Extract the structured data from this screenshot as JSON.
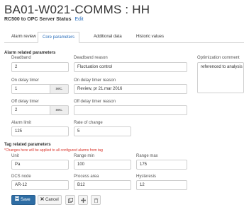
{
  "header": {
    "title": "BA01-W021-COMMS : HH",
    "subtitle": "RC500 to OPC Server Status",
    "edit_link": "Edit"
  },
  "tabs": [
    {
      "label": "Alarm review",
      "active": false
    },
    {
      "label": "Core parameters",
      "active": true
    },
    {
      "label": "Additional data",
      "active": false
    },
    {
      "label": "Historic values",
      "active": false
    }
  ],
  "alarm_section": {
    "title": "Alarm related parameters",
    "deadband": {
      "label": "Deadband",
      "value": "2"
    },
    "deadband_reason": {
      "label": "Deadband reason",
      "value": "Fluctuation control"
    },
    "optimization_comment": {
      "label": "Optimization comment",
      "value": "referenced to analysis"
    },
    "on_delay_timer": {
      "label": "On delay timer",
      "value": "1",
      "unit": "sec."
    },
    "on_delay_timer_reason": {
      "label": "On delay timer reason",
      "value": "Review, pr 21.mar 2016"
    },
    "off_delay_timer": {
      "label": "Off delay timer",
      "value": "2",
      "unit": "sec."
    },
    "off_delay_timer_reason": {
      "label": "Off delay timer reason",
      "value": ""
    },
    "alarm_limit": {
      "label": "Alarm limit",
      "value": "125"
    },
    "rate_of_change": {
      "label": "Rate of change",
      "value": "5"
    }
  },
  "tag_section": {
    "title": "Tag related parameters",
    "warning": "*Changes here will be applied to all configured alarms from tag",
    "unit": {
      "label": "Unit",
      "value": "Pa"
    },
    "range_min": {
      "label": "Range min",
      "value": "100"
    },
    "range_max": {
      "label": "Range max",
      "value": "175"
    },
    "dcs_node": {
      "label": "DCS node",
      "value": "AR-12"
    },
    "process_area": {
      "label": "Process area",
      "value": "B12"
    },
    "hysteresis": {
      "label": "Hysteresis",
      "value": "12"
    }
  },
  "toolbar": {
    "save_label": "Save",
    "cancel_label": "Cancel"
  },
  "icons": {
    "save": "save-icon",
    "cancel": "close-icon",
    "copy": "copy-icon",
    "add": "plus-icon",
    "delete": "trash-icon"
  }
}
